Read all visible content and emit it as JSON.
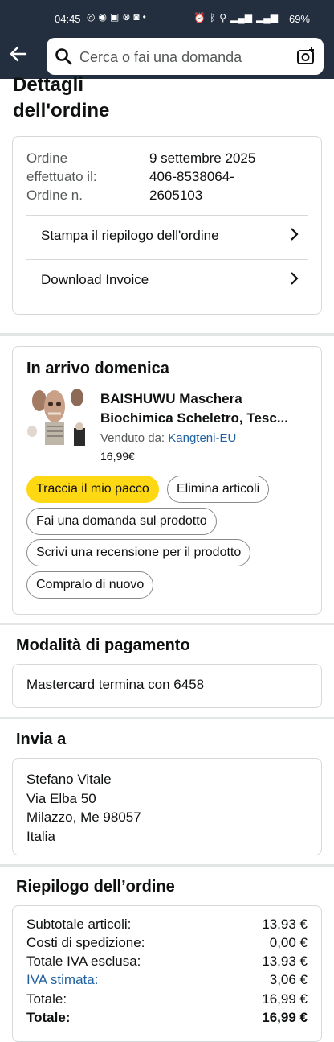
{
  "status_bar": {
    "time": "04:45",
    "battery": "69%"
  },
  "header": {
    "search_placeholder": "Cerca o fai una domanda"
  },
  "page": {
    "title_line1": "Dettagli",
    "title_line2": "dell'ordine"
  },
  "order_info": {
    "date_label_1": "Ordine",
    "date_label_2": "effettuato il:",
    "date_value": "9 settembre 2025",
    "number_label": "Ordine n.",
    "number_value_1": "406-8538064-",
    "number_value_2": "2605103",
    "print_summary": "Stampa il riepilogo dell'ordine",
    "download_invoice": "Download Invoice"
  },
  "shipment": {
    "heading": "In arrivo domenica",
    "product_title_1": "BAISHUWU Maschera",
    "product_title_2": "Biochimica Scheletro, Tesc...",
    "sold_by_label": "Venduto da:",
    "seller": "Kangteni-EU",
    "price": "16,99€",
    "btn_track": "Traccia il mio pacco",
    "btn_delete": "Elimina articoli",
    "btn_question": "Fai una domanda sul prodotto",
    "btn_review": "Scrivi una recensione per il prodotto",
    "btn_buy_again": "Compralo di nuovo"
  },
  "payment": {
    "heading": "Modalità di pagamento",
    "method": "Mastercard termina con 6458"
  },
  "shipping_address": {
    "heading": "Invia a",
    "name": "Stefano Vitale",
    "street": "Via Elba 50",
    "city": "Milazzo, Me 98057",
    "country": "Italia"
  },
  "summary": {
    "heading": "Riepilogo dell’ordine",
    "rows": [
      {
        "label": "Subtotale articoli:",
        "value": "13,93 €"
      },
      {
        "label": "Costi di spedizione:",
        "value": "0,00 €"
      },
      {
        "label": "Totale IVA esclusa:",
        "value": "13,93 €"
      },
      {
        "label": "IVA stimata:",
        "value": "3,06 €"
      },
      {
        "label": "Totale:",
        "value": "16,99 €"
      },
      {
        "label": "Totale:",
        "value": "16,99 €"
      }
    ]
  },
  "colors": {
    "header_bg": "#232f3e",
    "primary_button": "#ffd814",
    "link": "#2162a1"
  }
}
